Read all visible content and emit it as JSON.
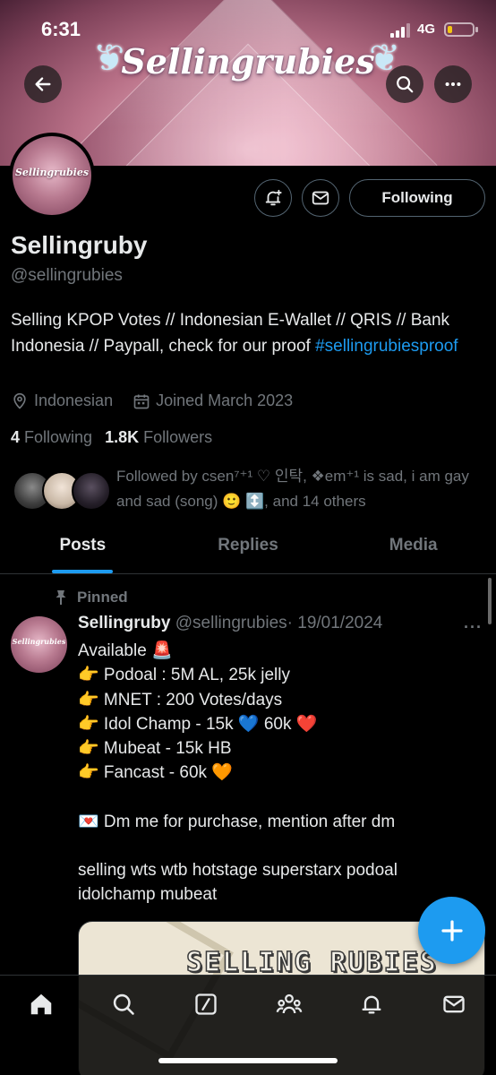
{
  "status_bar": {
    "time": "6:31",
    "network": "4G",
    "battery_level": 0.2
  },
  "banner": {
    "logo_text": "Sellingrubies"
  },
  "profile": {
    "avatar_text": "Sellingrubies",
    "following_button": "Following",
    "name": "Sellingruby",
    "handle": "@sellingrubies",
    "bio": "Selling KPOP Votes // Indonesian E-Wallet // QRIS // Bank Indonesia // Paypall, check for our proof ",
    "bio_hashtag": "#sellingrubiesproof",
    "location": "Indonesian",
    "joined": "Joined March 2023",
    "following_count": "4",
    "following_label": "Following",
    "followers_count": "1.8K",
    "followers_label": "Followers",
    "followed_by": "Followed by csen⁷⁺¹ ♡ 인탁, ❖em⁺¹ is sad, i am gay and sad (song) 🙂 ↕️, and 14 others"
  },
  "tabs": [
    {
      "label": "Posts",
      "active": true
    },
    {
      "label": "Replies",
      "active": false
    },
    {
      "label": "Media",
      "active": false
    }
  ],
  "post": {
    "pinned_label": "Pinned",
    "avatar_text": "Sellingrubies",
    "author_name": "Sellingruby",
    "author_handle": "@sellingrubies",
    "date": "· 19/01/2024",
    "lines": [
      "Available 🚨",
      "👉 Podoal : 5M AL, 25k jelly",
      "👉 MNET : 200 Votes/days",
      "👉 Idol Champ - 15k 💙 60k ❤️",
      "👉 Mubeat - 15k HB",
      "👉 Fancast - 60k 🧡",
      "",
      "💌 Dm me for purchase, mention after dm",
      "",
      "selling wts wtb hotstage superstarx podoal idolchamp mubeat"
    ],
    "media_text": "SELLING RUBIES"
  },
  "colors": {
    "accent": "#1d9bf0",
    "background": "#000000",
    "muted": "#71767b"
  },
  "nav": [
    "home-icon",
    "search-icon",
    "grok-icon",
    "communities-icon",
    "notifications-icon",
    "messages-icon"
  ]
}
